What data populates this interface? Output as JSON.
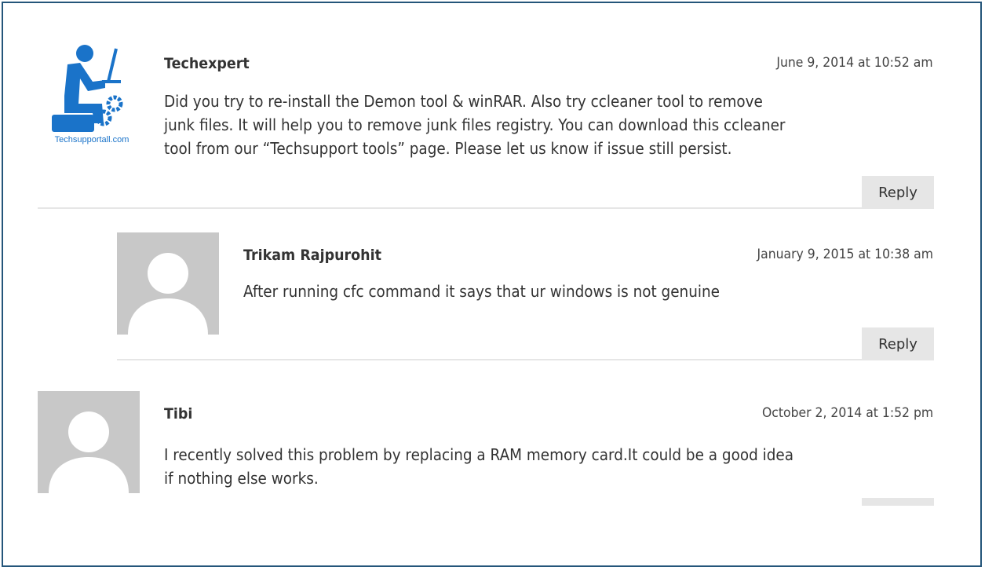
{
  "comments": [
    {
      "author": "Techexpert",
      "date": "June 9, 2014 at 10:52 am",
      "text_lines": [
        "Did you try to re-install the Demon tool & winRAR. Also try ccleaner tool to remove",
        "junk files. It will help you to remove junk files registry. You can download this ccleaner",
        "tool from our “Techsupport tools” page. Please let us know if issue still persist."
      ],
      "reply_label": "Reply",
      "avatar": {
        "type": "logo",
        "icon": "techsupport-logo-icon",
        "caption": "Techsupportall.com",
        "color": "#1a73c9"
      }
    },
    {
      "author": "Trikam Rajpurohit",
      "date": "January 9, 2015 at 10:38 am",
      "text_lines": [
        "After running cfc command it says that ur windows is not genuine"
      ],
      "reply_label": "Reply",
      "avatar": {
        "type": "default",
        "icon": "default-avatar-icon"
      }
    },
    {
      "author": "Tibi",
      "date": "October 2, 2014 at 1:52 pm",
      "text_lines": [
        "I recently solved this problem by replacing a RAM memory card.It could be a good idea",
        "if nothing else works."
      ],
      "reply_label": "",
      "avatar": {
        "type": "default",
        "icon": "default-avatar-icon"
      }
    }
  ],
  "colors": {
    "frame_border": "#24557a",
    "reply_bg": "#e6e6e6",
    "divider": "#e6e6e6",
    "avatar_bg": "#c8c8c8",
    "logo_blue": "#1a73c9"
  }
}
